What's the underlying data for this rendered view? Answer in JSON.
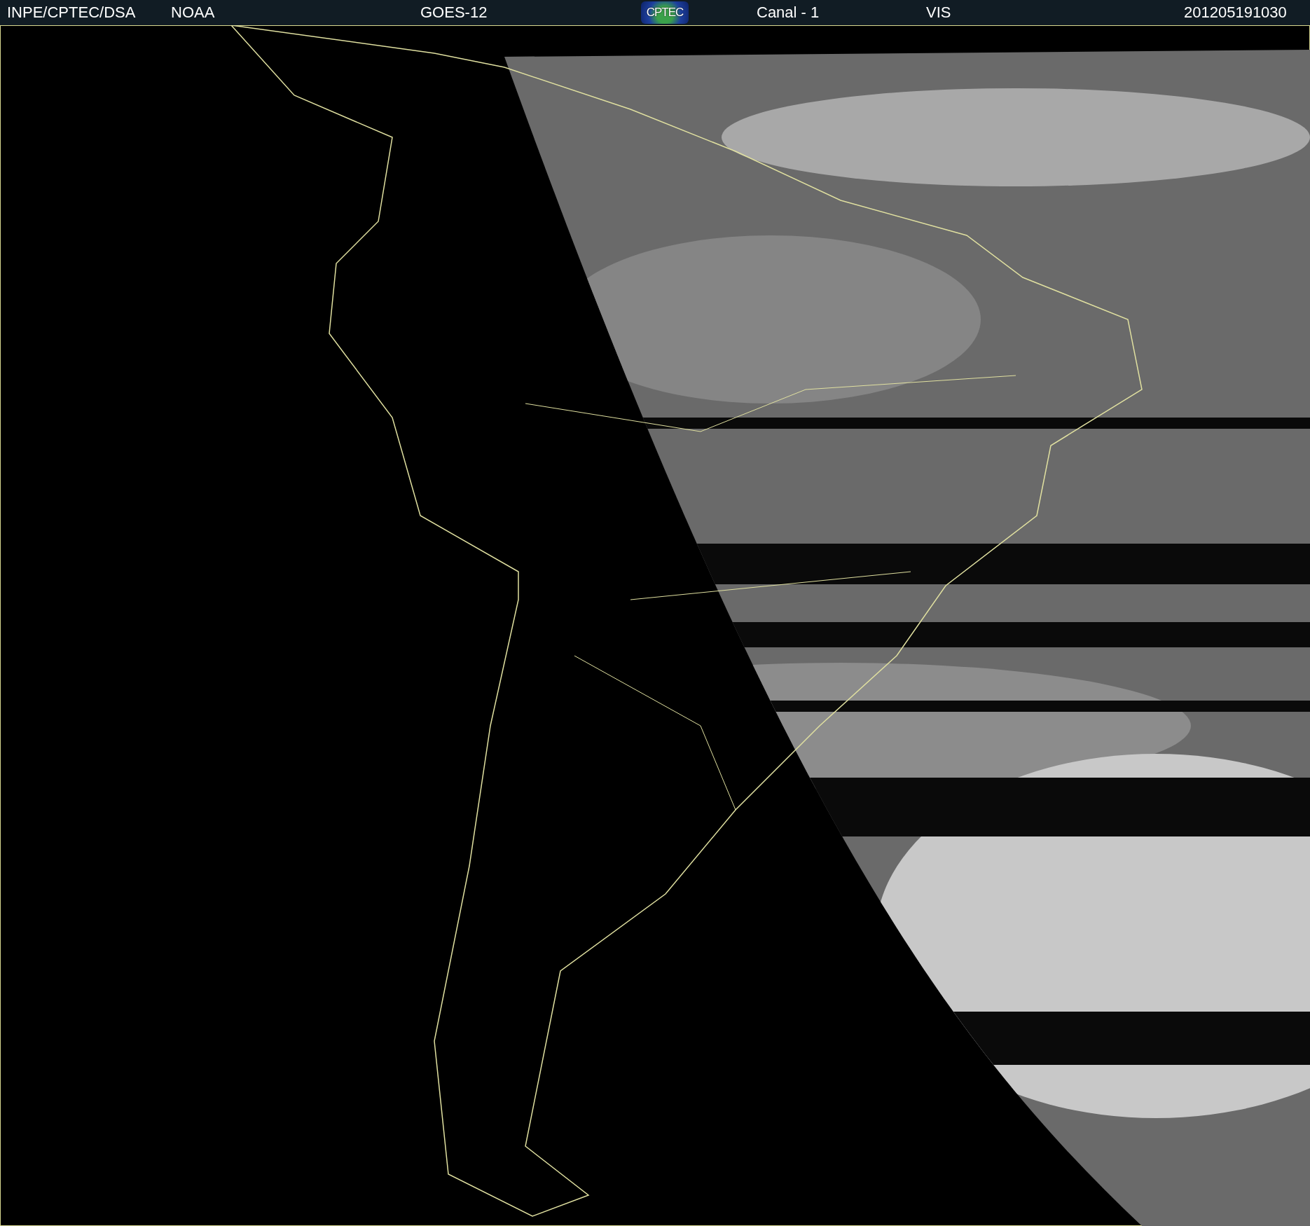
{
  "header": {
    "items": [
      {
        "kind": "text",
        "text": "INPE/CPTEC/DSA"
      },
      {
        "kind": "text",
        "text": "NOAA"
      },
      {
        "kind": "text",
        "text": "GOES-12"
      },
      {
        "kind": "logo",
        "text": "CPTEC"
      },
      {
        "kind": "text",
        "text": "Canal - 1"
      },
      {
        "kind": "text",
        "text": "VIS"
      },
      {
        "kind": "text",
        "text": "201205191030"
      }
    ]
  }
}
